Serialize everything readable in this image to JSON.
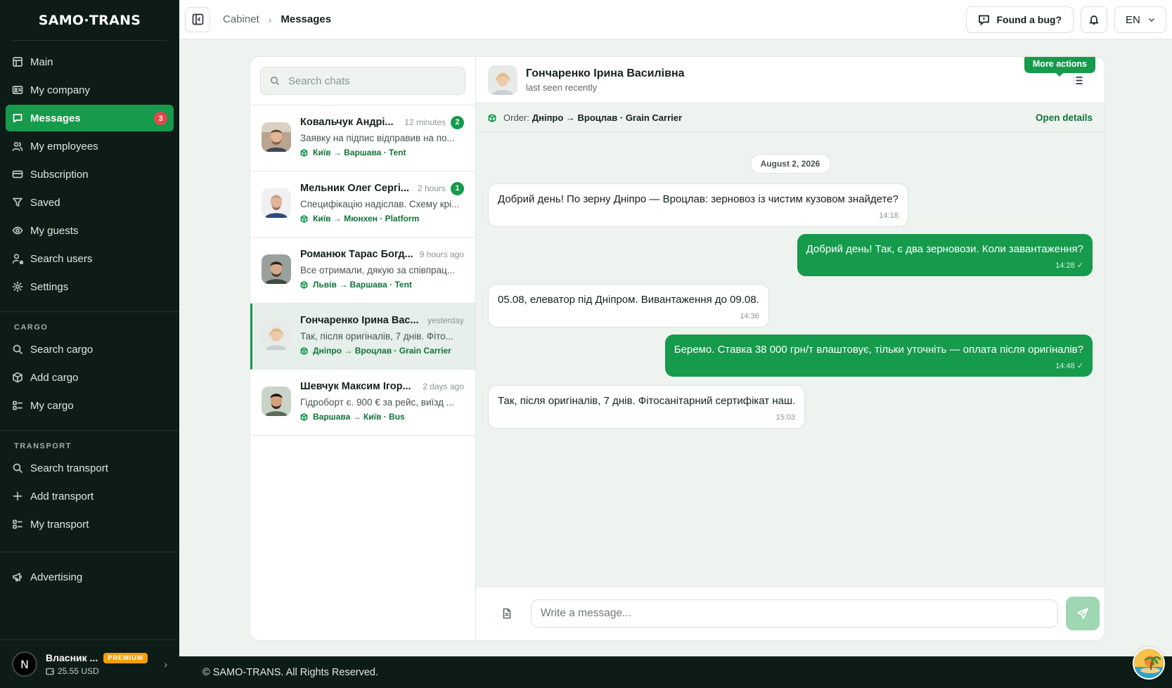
{
  "brand": {
    "logo": "SAMO·TRANS"
  },
  "sidebar": {
    "main_items": [
      {
        "label": "Main",
        "icon": "table-icon"
      },
      {
        "label": "My company",
        "icon": "id-card-icon"
      },
      {
        "label": "Messages",
        "icon": "message-icon",
        "badge": "3",
        "active": true
      },
      {
        "label": "My employees",
        "icon": "users-icon"
      },
      {
        "label": "Subscription",
        "icon": "credit-card-icon"
      },
      {
        "label": "Saved",
        "icon": "filter-icon"
      },
      {
        "label": "My guests",
        "icon": "eye-icon"
      },
      {
        "label": "Search users",
        "icon": "user-search-icon"
      },
      {
        "label": "Settings",
        "icon": "gear-icon"
      }
    ],
    "cargo_title": "CARGO",
    "cargo_items": [
      {
        "label": "Search cargo",
        "icon": "search-icon"
      },
      {
        "label": "Add cargo",
        "icon": "box-icon"
      },
      {
        "label": "My cargo",
        "icon": "list-icon"
      }
    ],
    "transport_title": "TRANSPORT",
    "transport_items": [
      {
        "label": "Search transport",
        "icon": "search-icon"
      },
      {
        "label": "Add transport",
        "icon": "plus-icon"
      },
      {
        "label": "My transport",
        "icon": "list-icon"
      }
    ],
    "advertising": {
      "label": "Advertising",
      "icon": "megaphone-icon"
    },
    "user": {
      "avatar_letter": "N",
      "name": "Власник ...",
      "plan": "PREMIUM",
      "balance": "25.55 USD"
    }
  },
  "topbar": {
    "breadcrumb": [
      "Cabinet",
      "Messages"
    ],
    "bug_button": "Found a bug?",
    "language": "EN"
  },
  "chat_list": {
    "search_placeholder": "Search chats",
    "conversations": [
      {
        "name": "Ковальчук Андрі...",
        "time": "12 minutes",
        "unread": "2",
        "preview": "Заявку на підпис відправив на по...",
        "route": "Київ → Варшава · Tent"
      },
      {
        "name": "Мельник Олег Сергі...",
        "time": "2 hours",
        "unread": "1",
        "preview": "Специфікацію надіслав. Схему крі...",
        "route": "Київ → Мюнхен · Platform"
      },
      {
        "name": "Романюк Тарас Богд...",
        "time": "9 hours ago",
        "unread": "",
        "preview": "Все отримали, дякую за співпрац...",
        "route": "Львів → Варшава · Tent"
      },
      {
        "name": "Гончаренко Ірина Вас...",
        "time": "yesterday",
        "unread": "",
        "preview": "Так, після оригіналів, 7 днів. Фіто...",
        "route": "Дніпро → Вроцлав · Grain Carrier",
        "active": true
      },
      {
        "name": "Шевчук Максим Ігор...",
        "time": "2 days ago",
        "unread": "",
        "preview": "Гідроборт є. 900 € за рейс, виїзд ...",
        "route": "Варшава → Київ · Bus"
      }
    ]
  },
  "conversation": {
    "name": "Гончаренко Ірина Василівна",
    "status": "last seen recently",
    "more_tooltip": "More actions",
    "order_label": "Order:",
    "order_value": "Дніпро → Вроцлав · Grain Carrier",
    "open_details": "Open details",
    "date": "August 2, 2026",
    "messages": [
      {
        "dir": "in",
        "text": "Добрий день! По зерну Дніпро — Вроцлав: зерновоз із чистим кузовом знайдете?",
        "time": "14:18"
      },
      {
        "dir": "out",
        "text": "Добрий день! Так, є два зерновози. Коли завантаження?",
        "time": "14:28 ✓"
      },
      {
        "dir": "in",
        "text": "05.08, елеватор під Дніпром. Вивантаження до 09.08.",
        "time": "14:36"
      },
      {
        "dir": "out",
        "text": "Беремо. Ставка 38 000 грн/т влаштовує, тільки уточніть — оплата після оригіналів?",
        "time": "14:48 ✓"
      },
      {
        "dir": "in",
        "text": "Так, після оригіналів, 7 днів. Фітосанітарний сертифікат наш.",
        "time": "15:03"
      }
    ],
    "composer_placeholder": "Write a message..."
  },
  "footer": {
    "text": "© SAMO-TRANS. All Rights Reserved."
  },
  "colors": {
    "brand_green": "#169a4c",
    "sidebar_bg": "#0d1c16",
    "badge_red": "#e5484d",
    "premium": "#f59e0b"
  }
}
